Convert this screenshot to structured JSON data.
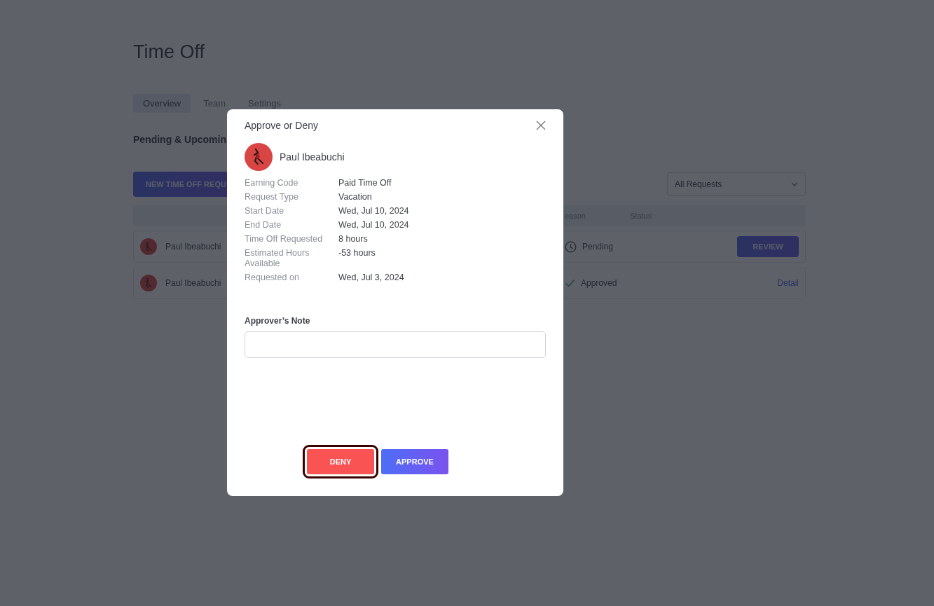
{
  "page": {
    "title": "Time Off",
    "tabs": [
      {
        "label": "Overview",
        "selected": true
      },
      {
        "label": "Team",
        "selected": false
      },
      {
        "label": "Settings",
        "selected": false
      }
    ],
    "section_heading": "Pending & Upcomin",
    "new_request_button": "NEW TIME OFF REQU",
    "filter": {
      "value": "All Requests"
    },
    "table": {
      "columns": [
        "eason",
        "Status"
      ],
      "rows": [
        {
          "name": "Paul Ibeabuchi",
          "status": "Pending",
          "kind": "pending",
          "action": {
            "kind": "button",
            "label": "REVIEW"
          }
        },
        {
          "name": "Paul Ibeabuchi",
          "status": "Approved",
          "kind": "approved",
          "action": {
            "kind": "link",
            "label": "Detail"
          }
        }
      ]
    }
  },
  "modal": {
    "title": "Approve or Deny",
    "employee": "Paul Ibeabuchi",
    "details": [
      {
        "label": "Earning Code",
        "value": "Paid Time Off"
      },
      {
        "label": "Request Type",
        "value": "Vacation"
      },
      {
        "label": "Start Date",
        "value": "Wed, Jul 10, 2024"
      },
      {
        "label": "End Date",
        "value": "Wed, Jul 10, 2024"
      },
      {
        "label": "Time Off Requested",
        "value": "8 hours"
      },
      {
        "label": "Estimated Hours Available",
        "value": "-53 hours"
      },
      {
        "label": "Requested on",
        "value": "Wed, Jul 3, 2024"
      }
    ],
    "note": {
      "label": "Approver’s Note"
    },
    "buttons": [
      {
        "label": "DENY",
        "kind": "deny",
        "focused": true
      },
      {
        "label": "APPROVE",
        "kind": "approve",
        "focused": false
      }
    ]
  }
}
